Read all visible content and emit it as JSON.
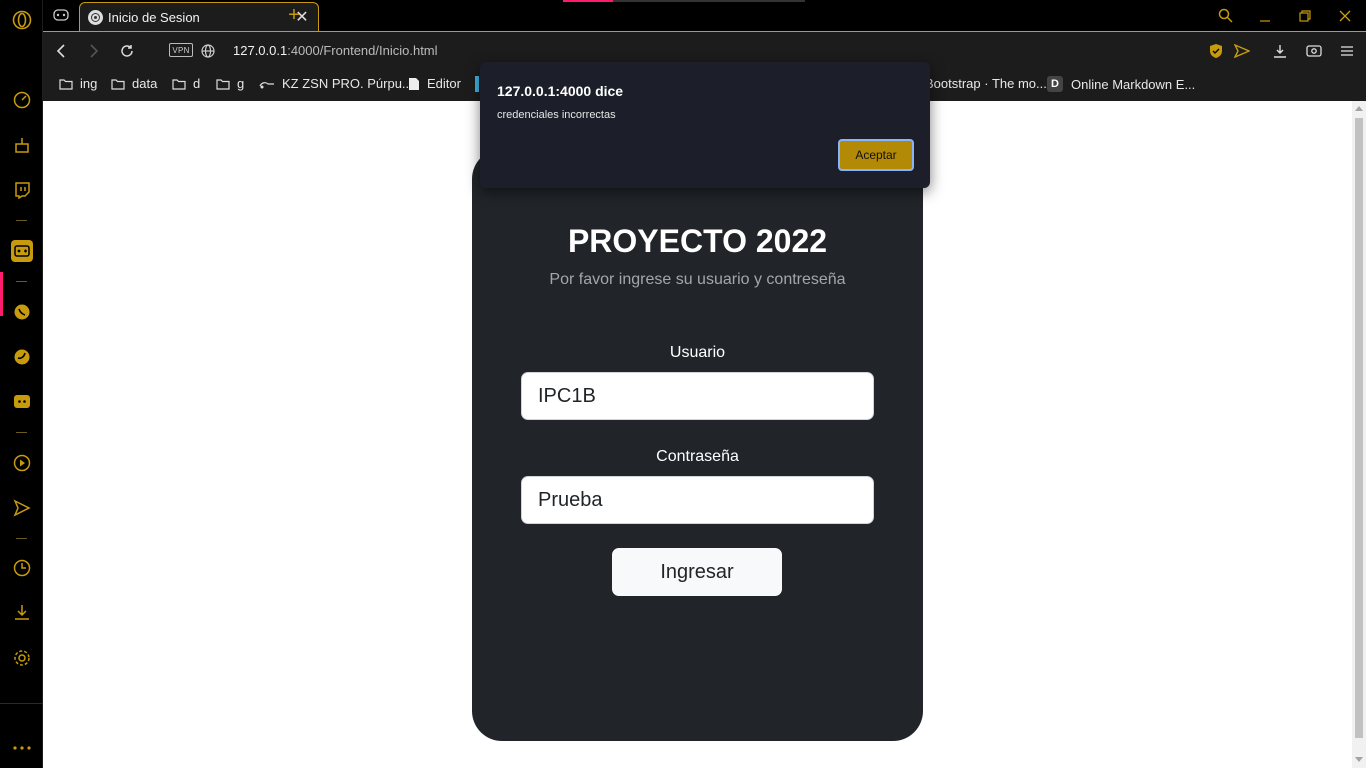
{
  "browser": {
    "tab": {
      "title": "Inicio de Sesion"
    },
    "address": {
      "host": "127.0.0.1",
      "rest": ":4000/Frontend/Inicio.html",
      "vpn_label": "VPN"
    },
    "bookmarks": [
      {
        "label": "ing",
        "icon": "folder-icon"
      },
      {
        "label": "data",
        "icon": "folder-icon"
      },
      {
        "label": "d",
        "icon": "folder-icon"
      },
      {
        "label": "g",
        "icon": "folder-icon"
      },
      {
        "label": "KZ ZSN PRO. Púrpu...",
        "icon": "earphones-icon"
      },
      {
        "label": "Editor",
        "icon": "file-icon"
      },
      {
        "label": "Bootstrap · The mo...",
        "icon": "bootstrap-icon"
      },
      {
        "label": "Online Markdown E...",
        "icon": "d-icon"
      }
    ],
    "accent_color": "#c79b0c"
  },
  "page": {
    "title": "PROYECTO 2022",
    "subtitle": "Por favor ingrese su usuario y contreseña",
    "user_label": "Usuario",
    "user_value": "IPC1B",
    "pass_label": "Contraseña",
    "pass_value": "Prueba",
    "submit_label": "Ingresar"
  },
  "dialog": {
    "title": "127.0.0.1:4000 dice",
    "message": "credenciales incorrectas",
    "ok_label": "Aceptar"
  }
}
